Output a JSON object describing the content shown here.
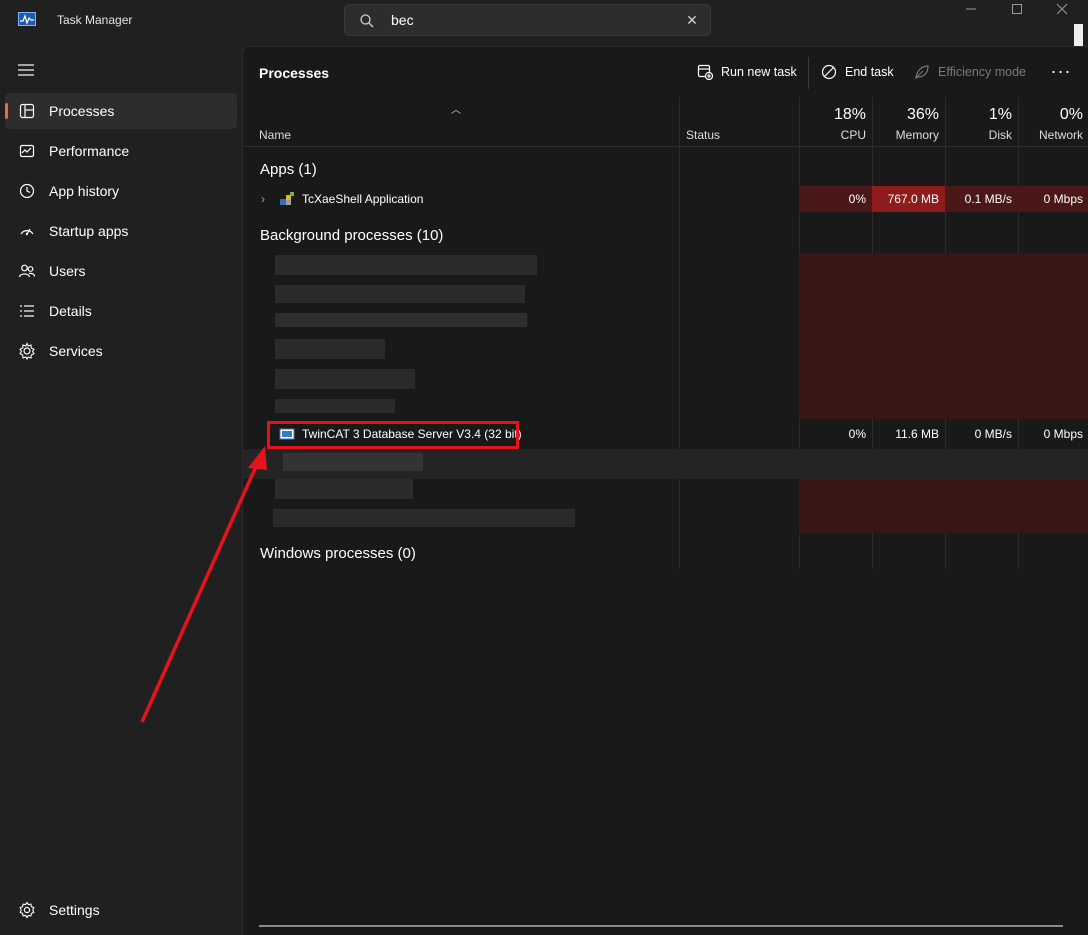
{
  "window": {
    "title": "Task Manager"
  },
  "search": {
    "value": "bec"
  },
  "sidebar": {
    "items": [
      {
        "label": "Processes",
        "icon": "processes-icon",
        "active": true
      },
      {
        "label": "Performance",
        "icon": "performance-icon"
      },
      {
        "label": "App history",
        "icon": "app-history-icon"
      },
      {
        "label": "Startup apps",
        "icon": "startup-apps-icon"
      },
      {
        "label": "Users",
        "icon": "users-icon"
      },
      {
        "label": "Details",
        "icon": "details-icon"
      },
      {
        "label": "Services",
        "icon": "services-icon"
      }
    ],
    "settings_label": "Settings"
  },
  "page": {
    "title": "Processes"
  },
  "toolbar": {
    "run_new_task": "Run new task",
    "end_task": "End task",
    "efficiency_mode": "Efficiency mode",
    "more": "···"
  },
  "columns": {
    "name": "Name",
    "status": "Status",
    "cpu": {
      "pct": "18%",
      "label": "CPU"
    },
    "memory": {
      "pct": "36%",
      "label": "Memory"
    },
    "disk": {
      "pct": "1%",
      "label": "Disk"
    },
    "network": {
      "pct": "0%",
      "label": "Network"
    }
  },
  "groups": {
    "apps": "Apps (1)",
    "background": "Background processes (10)",
    "windows": "Windows processes (0)"
  },
  "rows": {
    "tcxae": {
      "name": "TcXaeShell Application",
      "cpu": "0%",
      "memory": "767.0 MB",
      "disk": "0.1 MB/s",
      "network": "0 Mbps"
    },
    "twincat": {
      "name": "TwinCAT 3 Database Server V3.4 (32 bit)",
      "cpu": "0%",
      "memory": "11.6 MB",
      "disk": "0 MB/s",
      "network": "0 Mbps"
    }
  },
  "colors": {
    "accent": "#e66a4e",
    "highlight": "#e5141b",
    "heat_high": "#8e1c1c"
  }
}
